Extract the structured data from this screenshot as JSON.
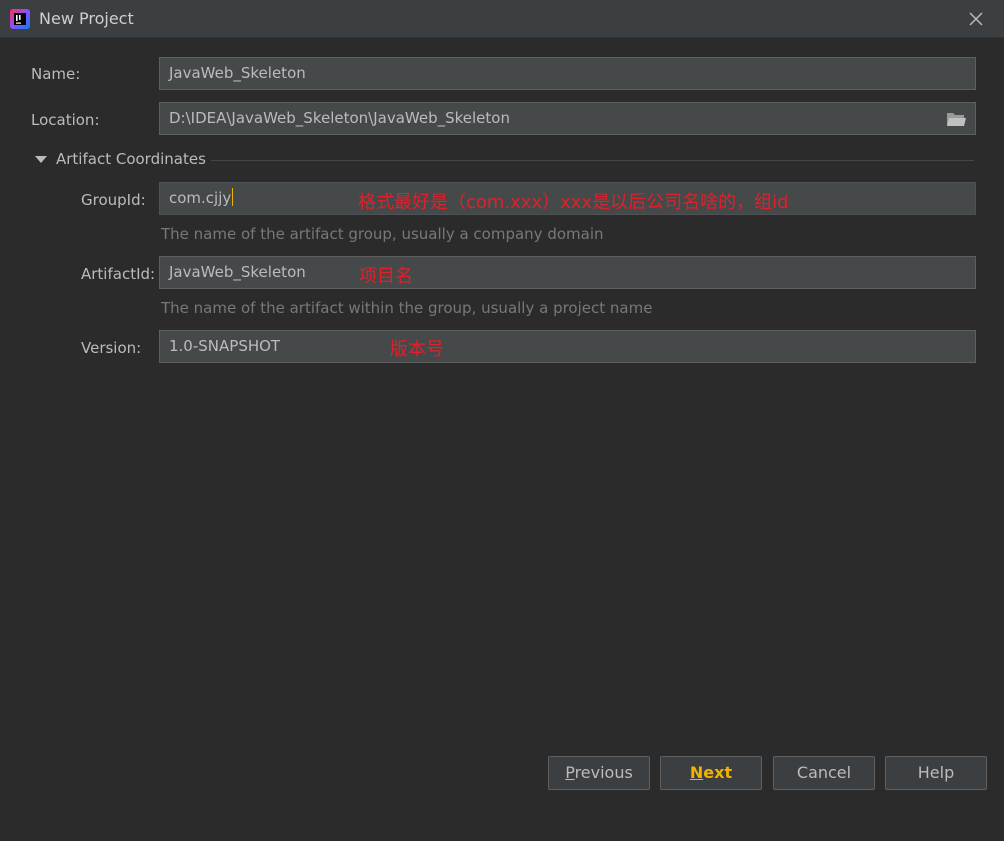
{
  "window": {
    "title": "New Project",
    "app_icon": "intellij-icon",
    "close_icon": "close-icon"
  },
  "form": {
    "name_label": "Name:",
    "name_value": "JavaWeb_Skeleton",
    "location_label": "Location:",
    "location_value": "D:\\IDEA\\JavaWeb_Skeleton\\JavaWeb_Skeleton",
    "section_title": "Artifact Coordinates",
    "groupid_label": "GroupId:",
    "groupid_value": "com.cjjy",
    "groupid_hint": "The name of the artifact group, usually a company domain",
    "artifactid_label": "ArtifactId:",
    "artifactid_value": "JavaWeb_Skeleton",
    "artifactid_hint": "The name of the artifact within the group, usually a project name",
    "version_label": "Version:",
    "version_value": "1.0-SNAPSHOT"
  },
  "annotations": {
    "groupid_note": "格式最好是（com.xxx）xxx是以后公司名啥的，组id",
    "artifactid_note": "项目名",
    "version_note": "版本号"
  },
  "buttons": {
    "previous_mnemonic": "P",
    "previous_rest": "revious",
    "next_mnemonic": "N",
    "next_rest": "ext",
    "cancel": "Cancel",
    "help": "Help"
  },
  "colors": {
    "background": "#2b2b2b",
    "field_bg": "#45494a",
    "accent": "#f0b400",
    "annotation": "#e0202a"
  }
}
